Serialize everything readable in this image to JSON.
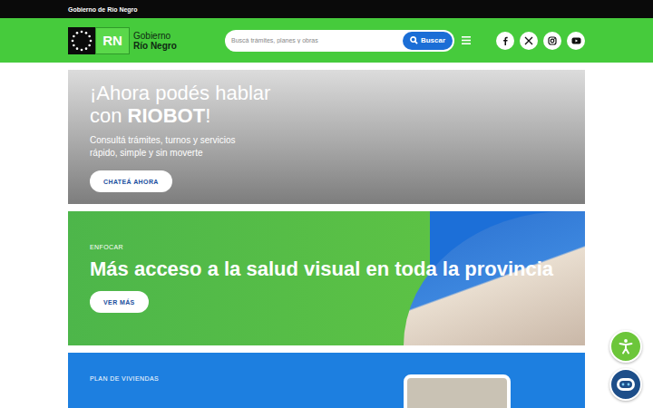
{
  "topbar": {
    "title": "Gobierno de Río Negro"
  },
  "logo": {
    "mark": "RN",
    "line1": "Gobierno",
    "line2": "Río Negro"
  },
  "search": {
    "placeholder": "Buscá trámites, planes y obras",
    "button": "Buscar"
  },
  "social": [
    "facebook",
    "x",
    "instagram",
    "youtube"
  ],
  "banners": [
    {
      "kind": "chat",
      "label": "",
      "title": [
        {
          "text": "¡Ahora podés hablar con ",
          "bold": false
        },
        {
          "text": "RIOBOT",
          "bold": true
        },
        {
          "text": "!",
          "bold": false
        }
      ],
      "subtitle": "Consultá trámites, turnos y servicios rápido, simple y sin moverte",
      "button": "CHATEÁ AHORA"
    },
    {
      "kind": "health",
      "label": "ENFOCAR",
      "title": [
        {
          "text": "Más acceso a la salud visual en toda la provincia",
          "bold": true
        }
      ],
      "subtitle": "",
      "button": "VER MÁS"
    },
    {
      "kind": "housing",
      "label": "PLAN DE VIVIENDAS",
      "title": [],
      "subtitle": "",
      "button": ""
    }
  ]
}
